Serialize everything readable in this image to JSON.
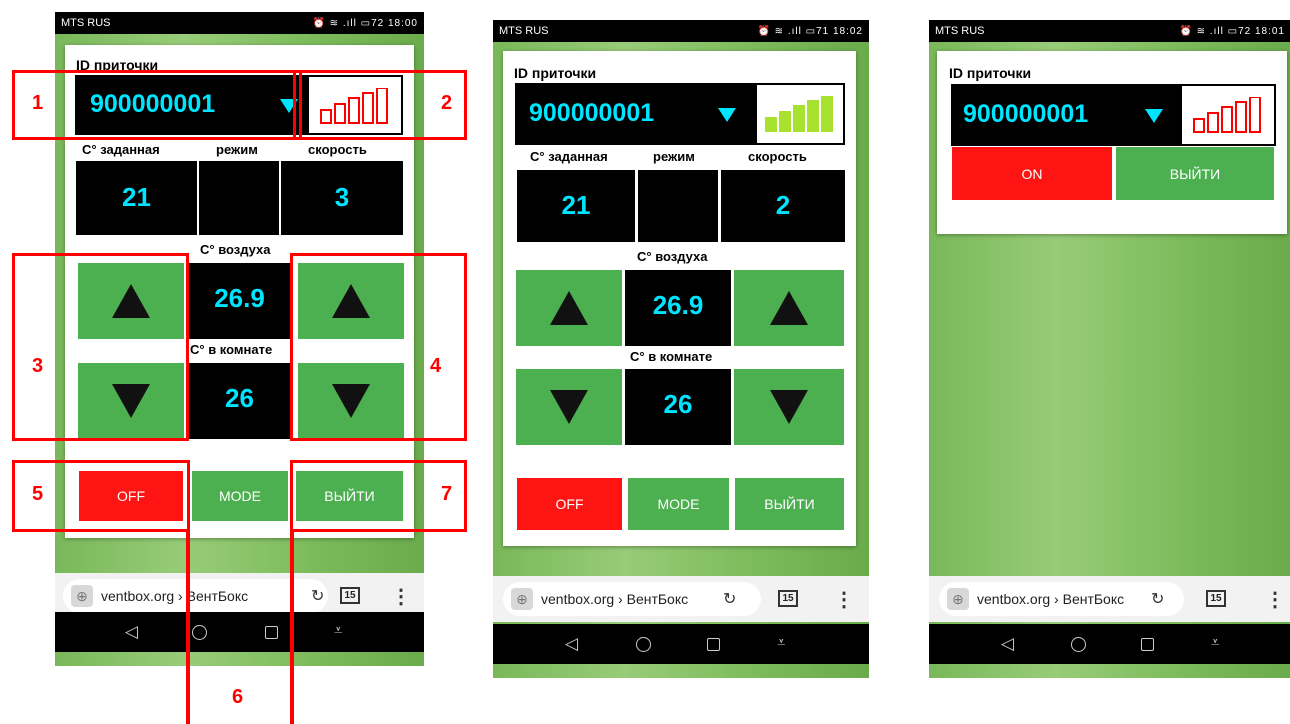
{
  "common": {
    "carrier": "MTS RUS",
    "id_label": "ID приточки",
    "device_id": "900000001",
    "setpoint_label": "С° заданная",
    "mode_label": "режим",
    "speed_label": "скорость",
    "air_label": "С° воздуха",
    "room_label": "С° в комнате",
    "off_label": "OFF",
    "on_label": "ON",
    "mode_button": "MODE",
    "exit_button": "ВЫЙТИ",
    "url": "ventbox.org › ВентБокс",
    "tab_count": "15",
    "mode_icon": "sun-icon",
    "up_icon": "triangle-up",
    "down_icon": "triangle-down"
  },
  "screens": [
    {
      "time": "18:00",
      "battery": "72",
      "signal_color": "#ff0000",
      "signal_level": 0,
      "setpoint": "21",
      "speed": "3",
      "air_temp": "26.9",
      "room_temp": "26"
    },
    {
      "time": "18:02",
      "battery": "71",
      "signal_color": "#a6e22e",
      "signal_level": 5,
      "setpoint": "21",
      "speed": "2",
      "air_temp": "26.9",
      "room_temp": "26"
    },
    {
      "time": "18:01",
      "battery": "72",
      "signal_color": "#ff0000",
      "signal_level": 0
    }
  ],
  "callouts": [
    "1",
    "2",
    "3",
    "4",
    "5",
    "6",
    "7"
  ],
  "colors": {
    "accent_cyan": "#00e5ff",
    "button_green": "#4caf50",
    "button_red": "#ff1414",
    "callout_red": "#ff0000"
  }
}
